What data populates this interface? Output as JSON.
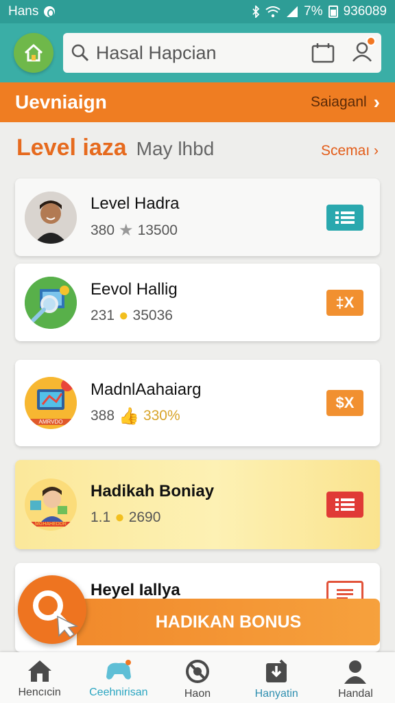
{
  "status_bar": {
    "left_text": "Hans",
    "battery_text": "7%",
    "time_text": "936089"
  },
  "top_bar": {
    "search_placeholder": "Hasal Hapcian"
  },
  "section": {
    "title": "Uevniaign",
    "link": "Saiaganl"
  },
  "list_header": {
    "title": "Level iaza",
    "subtitle": "May lhbd",
    "link": "Scemaı ›"
  },
  "items": [
    {
      "name": "Level Hadra",
      "count": "380",
      "meta_icon": "star-icon",
      "points": "13500",
      "action_icon": "list-icon",
      "action_color": "#2aa8ae"
    },
    {
      "name": "Eevol Hallig",
      "count": "231",
      "meta_icon": "coin-icon",
      "points": "35036",
      "action_icon": "dollar-x-icon",
      "action_color": "#f19030",
      "action_label": "‡X"
    },
    {
      "name": "MadnlAahaiarg",
      "count": "388",
      "meta_icon": "thumbs-up-icon",
      "points": "330%",
      "action_icon": "dollar-x-icon",
      "action_color": "#f19030",
      "action_label": "$X",
      "badge_text": "AMRVDO"
    },
    {
      "name": "Hadikah Boniay",
      "count": "1.1",
      "meta_icon": "coin-icon",
      "points": "2690",
      "action_icon": "list-icon",
      "action_color": "#e03a36",
      "badge_text": "MGHAHEDDR"
    },
    {
      "name": "Heyel Iallya",
      "action_icon": "list-icon",
      "action_color": "#e2533a"
    }
  ],
  "bonus_button": {
    "label": "HADIKAN BONUS"
  },
  "bottom_nav": [
    {
      "label": "Hencıcin",
      "icon": "home-icon"
    },
    {
      "label": "Ceehnirisan",
      "icon": "game-controller-icon",
      "active": true
    },
    {
      "label": "Haon",
      "icon": "block-icon"
    },
    {
      "label": "Hanyatin",
      "icon": "download-icon"
    },
    {
      "label": "Handal",
      "icon": "person-icon"
    }
  ]
}
